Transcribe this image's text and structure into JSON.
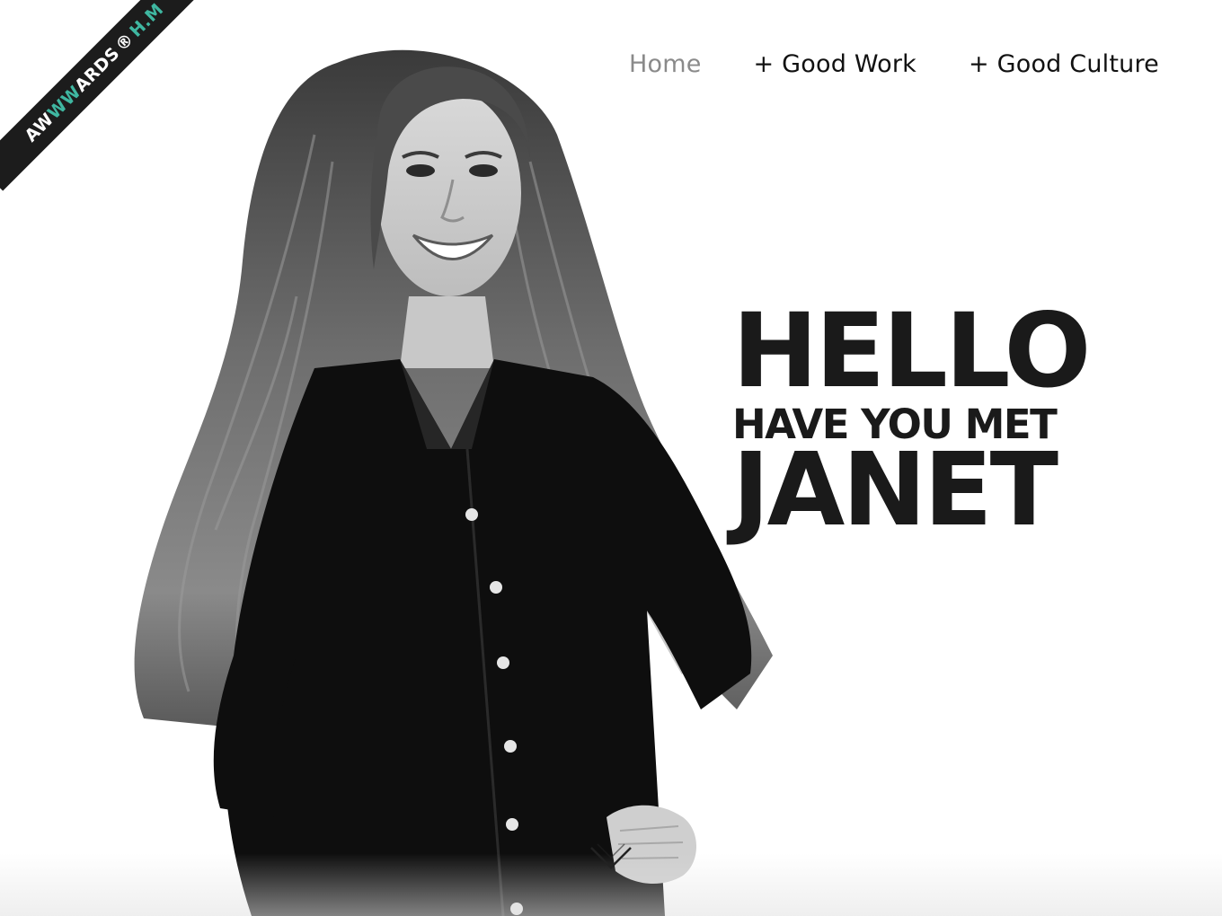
{
  "ribbon": {
    "brand_start": "AW",
    "brand_accent": "WW",
    "brand_end": "ARDS",
    "registered": "®",
    "award": "H.M",
    "accent_color": "#3fb7a1"
  },
  "nav": {
    "items": [
      {
        "label": "Home",
        "active": true
      },
      {
        "label": "+ Good Work",
        "active": false
      },
      {
        "label": "+ Good Culture",
        "active": false
      }
    ]
  },
  "hero": {
    "line1": "HELLO",
    "line2": "HAVE YOU MET",
    "line3": "JANET",
    "photo_icon": "portrait-photo"
  },
  "scroll": {
    "icon": "chevron-down-icon"
  },
  "colors": {
    "text": "#1a1a1a",
    "nav_active": "#8a8a8a",
    "background": "#ffffff"
  }
}
